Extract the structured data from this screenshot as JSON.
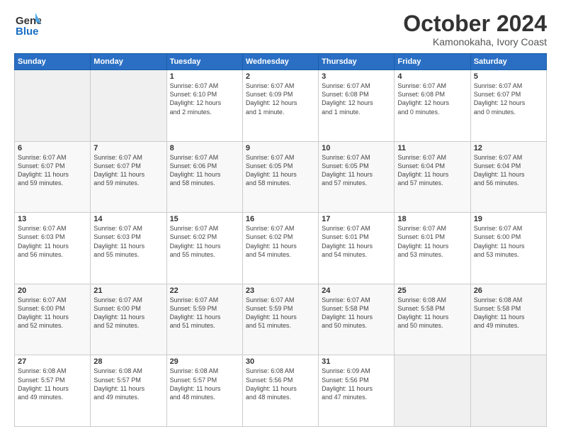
{
  "header": {
    "logo_line1": "General",
    "logo_line2": "Blue",
    "month": "October 2024",
    "location": "Kamonokaha, Ivory Coast"
  },
  "weekdays": [
    "Sunday",
    "Monday",
    "Tuesday",
    "Wednesday",
    "Thursday",
    "Friday",
    "Saturday"
  ],
  "weeks": [
    [
      {
        "day": "",
        "info": ""
      },
      {
        "day": "",
        "info": ""
      },
      {
        "day": "1",
        "info": "Sunrise: 6:07 AM\nSunset: 6:10 PM\nDaylight: 12 hours\nand 2 minutes."
      },
      {
        "day": "2",
        "info": "Sunrise: 6:07 AM\nSunset: 6:09 PM\nDaylight: 12 hours\nand 1 minute."
      },
      {
        "day": "3",
        "info": "Sunrise: 6:07 AM\nSunset: 6:08 PM\nDaylight: 12 hours\nand 1 minute."
      },
      {
        "day": "4",
        "info": "Sunrise: 6:07 AM\nSunset: 6:08 PM\nDaylight: 12 hours\nand 0 minutes."
      },
      {
        "day": "5",
        "info": "Sunrise: 6:07 AM\nSunset: 6:07 PM\nDaylight: 12 hours\nand 0 minutes."
      }
    ],
    [
      {
        "day": "6",
        "info": "Sunrise: 6:07 AM\nSunset: 6:07 PM\nDaylight: 11 hours\nand 59 minutes."
      },
      {
        "day": "7",
        "info": "Sunrise: 6:07 AM\nSunset: 6:07 PM\nDaylight: 11 hours\nand 59 minutes."
      },
      {
        "day": "8",
        "info": "Sunrise: 6:07 AM\nSunset: 6:06 PM\nDaylight: 11 hours\nand 58 minutes."
      },
      {
        "day": "9",
        "info": "Sunrise: 6:07 AM\nSunset: 6:05 PM\nDaylight: 11 hours\nand 58 minutes."
      },
      {
        "day": "10",
        "info": "Sunrise: 6:07 AM\nSunset: 6:05 PM\nDaylight: 11 hours\nand 57 minutes."
      },
      {
        "day": "11",
        "info": "Sunrise: 6:07 AM\nSunset: 6:04 PM\nDaylight: 11 hours\nand 57 minutes."
      },
      {
        "day": "12",
        "info": "Sunrise: 6:07 AM\nSunset: 6:04 PM\nDaylight: 11 hours\nand 56 minutes."
      }
    ],
    [
      {
        "day": "13",
        "info": "Sunrise: 6:07 AM\nSunset: 6:03 PM\nDaylight: 11 hours\nand 56 minutes."
      },
      {
        "day": "14",
        "info": "Sunrise: 6:07 AM\nSunset: 6:03 PM\nDaylight: 11 hours\nand 55 minutes."
      },
      {
        "day": "15",
        "info": "Sunrise: 6:07 AM\nSunset: 6:02 PM\nDaylight: 11 hours\nand 55 minutes."
      },
      {
        "day": "16",
        "info": "Sunrise: 6:07 AM\nSunset: 6:02 PM\nDaylight: 11 hours\nand 54 minutes."
      },
      {
        "day": "17",
        "info": "Sunrise: 6:07 AM\nSunset: 6:01 PM\nDaylight: 11 hours\nand 54 minutes."
      },
      {
        "day": "18",
        "info": "Sunrise: 6:07 AM\nSunset: 6:01 PM\nDaylight: 11 hours\nand 53 minutes."
      },
      {
        "day": "19",
        "info": "Sunrise: 6:07 AM\nSunset: 6:00 PM\nDaylight: 11 hours\nand 53 minutes."
      }
    ],
    [
      {
        "day": "20",
        "info": "Sunrise: 6:07 AM\nSunset: 6:00 PM\nDaylight: 11 hours\nand 52 minutes."
      },
      {
        "day": "21",
        "info": "Sunrise: 6:07 AM\nSunset: 6:00 PM\nDaylight: 11 hours\nand 52 minutes."
      },
      {
        "day": "22",
        "info": "Sunrise: 6:07 AM\nSunset: 5:59 PM\nDaylight: 11 hours\nand 51 minutes."
      },
      {
        "day": "23",
        "info": "Sunrise: 6:07 AM\nSunset: 5:59 PM\nDaylight: 11 hours\nand 51 minutes."
      },
      {
        "day": "24",
        "info": "Sunrise: 6:07 AM\nSunset: 5:58 PM\nDaylight: 11 hours\nand 50 minutes."
      },
      {
        "day": "25",
        "info": "Sunrise: 6:08 AM\nSunset: 5:58 PM\nDaylight: 11 hours\nand 50 minutes."
      },
      {
        "day": "26",
        "info": "Sunrise: 6:08 AM\nSunset: 5:58 PM\nDaylight: 11 hours\nand 49 minutes."
      }
    ],
    [
      {
        "day": "27",
        "info": "Sunrise: 6:08 AM\nSunset: 5:57 PM\nDaylight: 11 hours\nand 49 minutes."
      },
      {
        "day": "28",
        "info": "Sunrise: 6:08 AM\nSunset: 5:57 PM\nDaylight: 11 hours\nand 49 minutes."
      },
      {
        "day": "29",
        "info": "Sunrise: 6:08 AM\nSunset: 5:57 PM\nDaylight: 11 hours\nand 48 minutes."
      },
      {
        "day": "30",
        "info": "Sunrise: 6:08 AM\nSunset: 5:56 PM\nDaylight: 11 hours\nand 48 minutes."
      },
      {
        "day": "31",
        "info": "Sunrise: 6:09 AM\nSunset: 5:56 PM\nDaylight: 11 hours\nand 47 minutes."
      },
      {
        "day": "",
        "info": ""
      },
      {
        "day": "",
        "info": ""
      }
    ]
  ]
}
